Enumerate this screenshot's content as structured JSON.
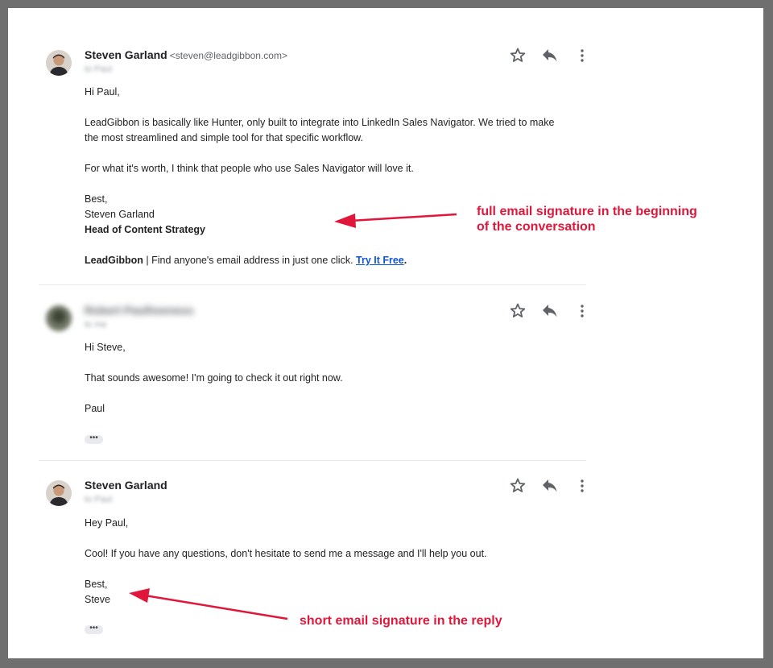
{
  "messages": [
    {
      "sender": "Steven Garland",
      "email": "<steven@leadgibbon.com>",
      "recipient": "to Paul",
      "greeting": "Hi Paul,",
      "p1_line1": "LeadGibbon is basically like Hunter, only built to integrate into LinkedIn Sales Navigator. We tried to make",
      "p1_line2": "the most streamlined and simple tool for that specific workflow.",
      "p2": "For what it's worth, I think that people who use Sales Navigator will love it.",
      "closing": "Best,",
      "name": "Steven Garland",
      "title": "Head of Content Strategy",
      "sig_brand": "LeadGibbon",
      "sig_text": " | Find anyone's email address in just one click. ",
      "sig_link": "Try It Free",
      "sig_end": "."
    },
    {
      "sender": "Robert Paulhoeness",
      "recipient": "to me",
      "greeting": "Hi Steve,",
      "p1": "That sounds awesome! I'm going to check it out right now.",
      "closing": "Paul",
      "ellipsis": "•••"
    },
    {
      "sender": "Steven Garland",
      "recipient": "to Paul",
      "greeting": "Hey Paul,",
      "p1": "Cool! If you have any questions, don't hesitate to send me a message and I'll help you out.",
      "closing": "Best,",
      "name": "Steve",
      "ellipsis": "•••"
    }
  ],
  "annotations": {
    "top_line1": "full email signature in the beginning",
    "top_line2": "of the conversation",
    "bottom": "short email signature in the reply",
    "color": "#e0173a"
  },
  "icons": [
    "star-icon",
    "reply-icon",
    "more-vert-icon"
  ]
}
